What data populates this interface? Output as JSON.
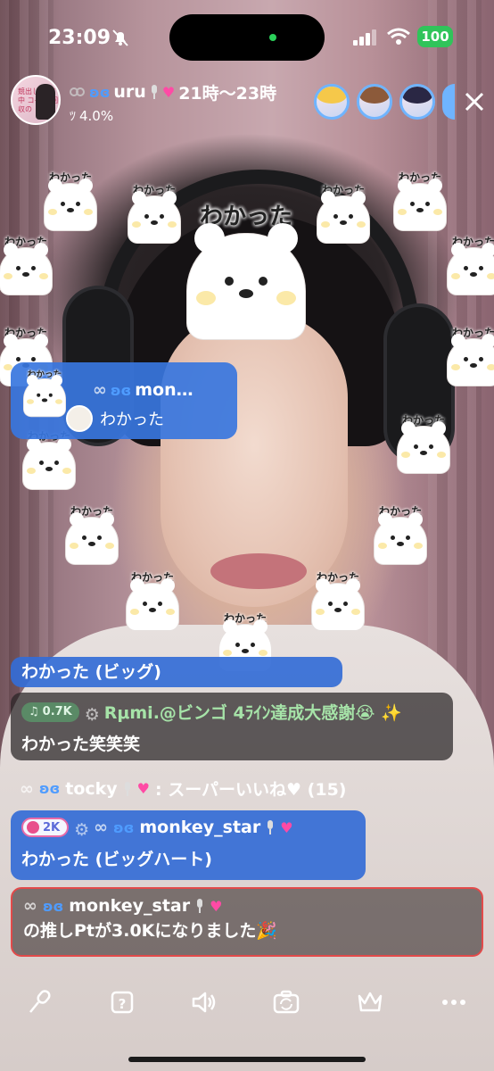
{
  "status_bar": {
    "time": "23:09",
    "battery": "100"
  },
  "header": {
    "host_name": "uru",
    "schedule": "21時〜23時",
    "rank_percent": "4.0%",
    "avatar_text": "競出し 配信中 コイン 回収の"
  },
  "stickers": {
    "label": "わかった",
    "big_label": "わかった"
  },
  "bubble": {
    "name": "mon…",
    "text": "わかった"
  },
  "chat": [
    {
      "text": "わかった (ビッグ)"
    },
    {
      "badge": "0.7K",
      "name": "Rμmi.@ビンゴ 4ﾗｲﾝ達成大感謝😭 ✨",
      "text": "わかった笑笑笑"
    },
    {
      "name": "tocky",
      "text": ": スーパーいいね♥ (15)"
    },
    {
      "badge": "2K",
      "name": "monkey_star",
      "text": "わかった (ビッグハート)"
    },
    {
      "name": "monkey_star",
      "text": "の推しPtが3.0Kになりました🎉"
    }
  ],
  "colors": {
    "accent_blue": "#346cd6",
    "battery_green": "#30c45a",
    "highlight_red": "#e24a4a"
  },
  "icons": [
    "mic-icon",
    "gift-box-icon",
    "speaker-icon",
    "camera-flip-icon",
    "crown-icon",
    "more-icon"
  ]
}
